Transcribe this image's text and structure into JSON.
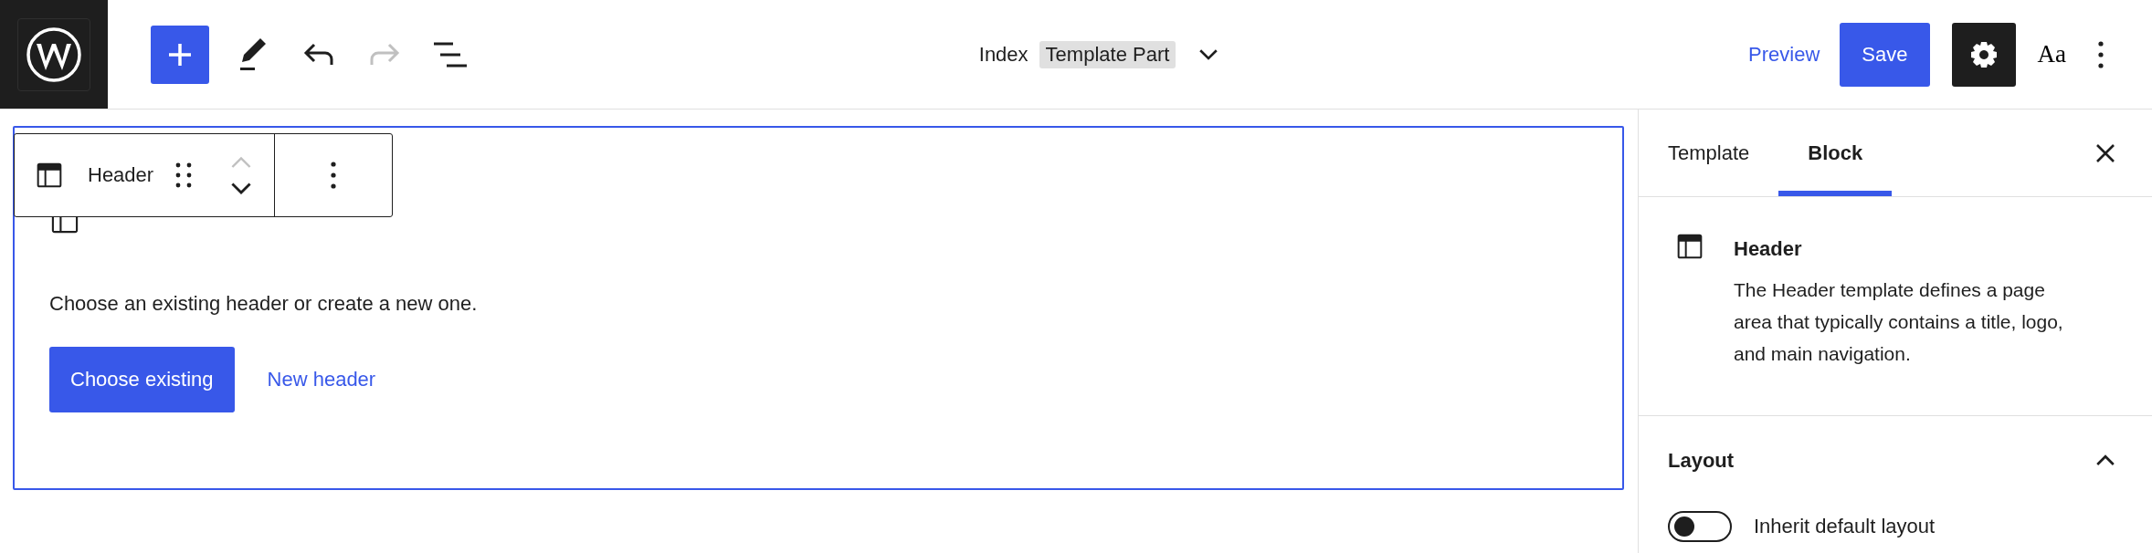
{
  "top_bar": {
    "tools": [
      {
        "kind": "inserter",
        "disabled": false
      },
      {
        "kind": "tools",
        "disabled": false
      },
      {
        "kind": "undo",
        "disabled": false
      },
      {
        "kind": "redo",
        "disabled": true
      },
      {
        "kind": "list-view",
        "disabled": false
      }
    ],
    "document": {
      "title": "Index",
      "badge": "Template Part"
    },
    "preview": "Preview",
    "save": "Save",
    "settings": {
      "pressed": true
    },
    "styles": "Aa"
  },
  "block_toolbar": {
    "label": "Header",
    "move_up_disabled": true,
    "move_down_disabled": false
  },
  "block": {
    "instructions": "Choose an existing header or create a new one.",
    "primary_button": "Choose existing",
    "secondary_link": "New header"
  },
  "sidebar": {
    "tabs": [
      {
        "label": "Template",
        "selected": false
      },
      {
        "label": "Block",
        "selected": true
      }
    ],
    "card": {
      "title": "Header",
      "description": "The Header template defines a page area that typically contains a title, logo, and main navigation."
    },
    "panels": [
      {
        "title": "Layout",
        "expanded": true,
        "toggles": [
          {
            "label": "Inherit default layout",
            "on": false
          }
        ]
      }
    ]
  }
}
